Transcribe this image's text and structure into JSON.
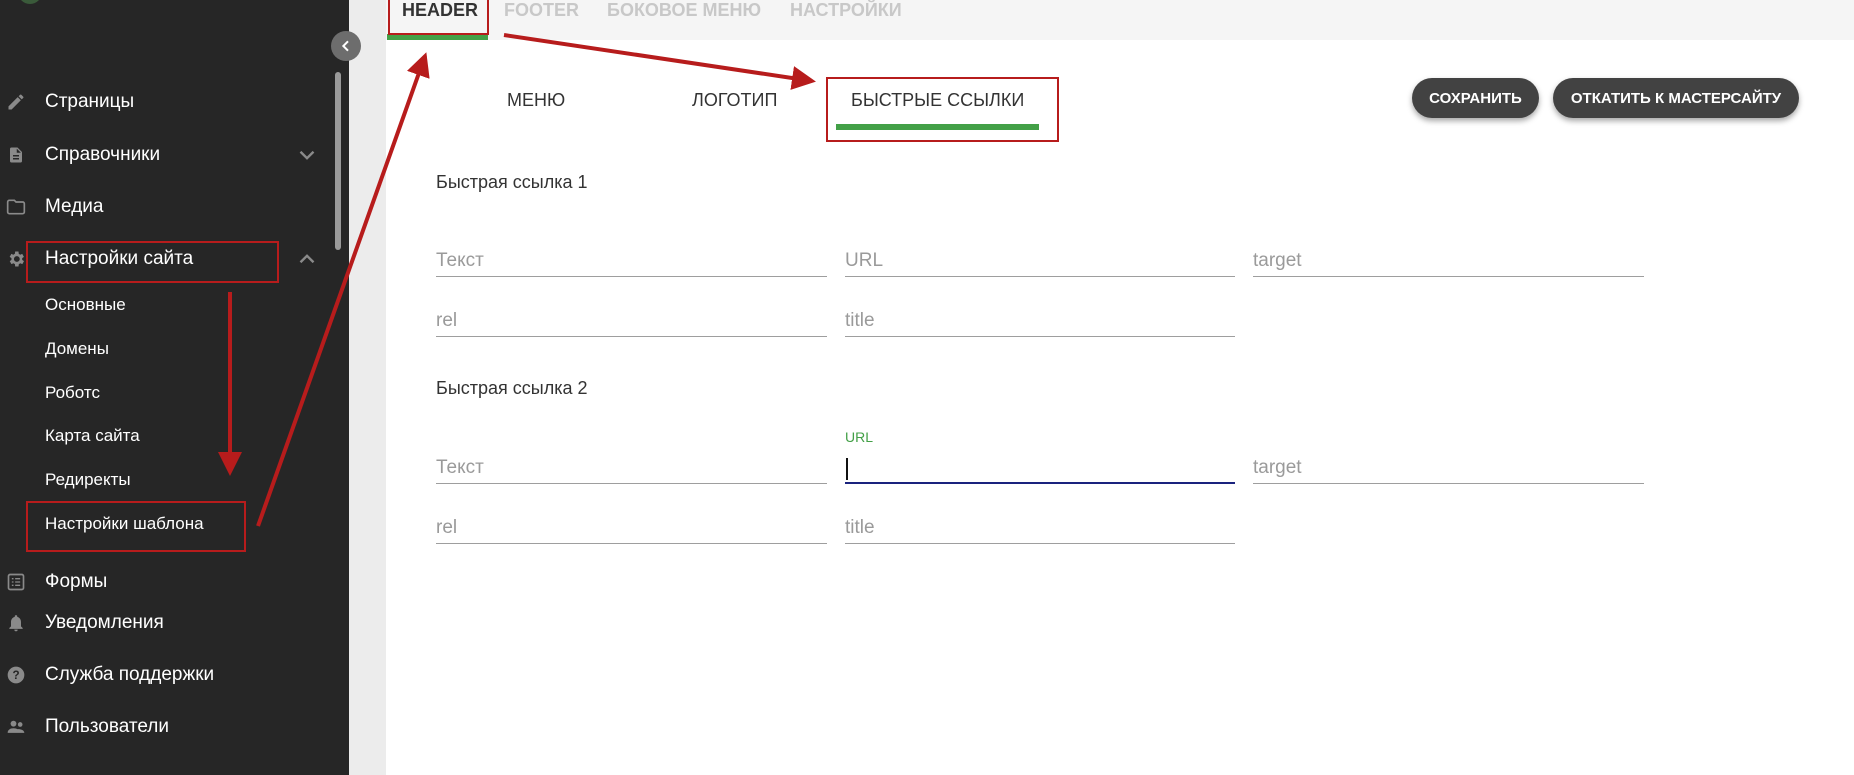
{
  "sidebar": {
    "items": [
      {
        "label": "Страницы",
        "icon": "pencil-icon"
      },
      {
        "label": "Справочники",
        "icon": "document-icon",
        "chevron": "chevron-down-icon"
      },
      {
        "label": "Медиа",
        "icon": "folder-icon"
      },
      {
        "label": "Настройки сайта",
        "icon": "gear-icon",
        "chevron": "chevron-up-icon"
      },
      {
        "label": "Формы",
        "icon": "list-icon"
      },
      {
        "label": "Уведомления",
        "icon": "bell-icon"
      },
      {
        "label": "Служба поддержки",
        "icon": "help-icon"
      },
      {
        "label": "Пользователи",
        "icon": "people-icon"
      }
    ],
    "subitems": [
      "Основные",
      "Домены",
      "Роботс",
      "Карта сайта",
      "Редиректы",
      "Настройки шаблона"
    ]
  },
  "top_tabs": [
    "HEADER",
    "FOOTER",
    "БОКОВОЕ МЕНЮ",
    "НАСТРОЙКИ"
  ],
  "sub_tabs": [
    "МЕНЮ",
    "ЛОГОТИП",
    "БЫСТРЫЕ ССЫЛКИ"
  ],
  "buttons": {
    "save": "СОХРАНИТЬ",
    "rollback": "ОТКАТИТЬ К МАСТЕРСАЙТУ"
  },
  "sections": [
    {
      "title": "Быстрая ссылка 1",
      "fields": {
        "text": "Текст",
        "url": "URL",
        "target": "target",
        "rel": "rel",
        "title": "title"
      }
    },
    {
      "title": "Быстрая ссылка 2",
      "fields": {
        "text": "Текст",
        "url": "",
        "target": "target",
        "rel": "rel",
        "title": "title"
      },
      "url_label": "URL"
    }
  ],
  "colors": {
    "accent": "#43a047",
    "annotation": "#b71c1c",
    "sidebar_bg": "#262626",
    "button_bg": "#424242",
    "focus": "#1a237e"
  }
}
